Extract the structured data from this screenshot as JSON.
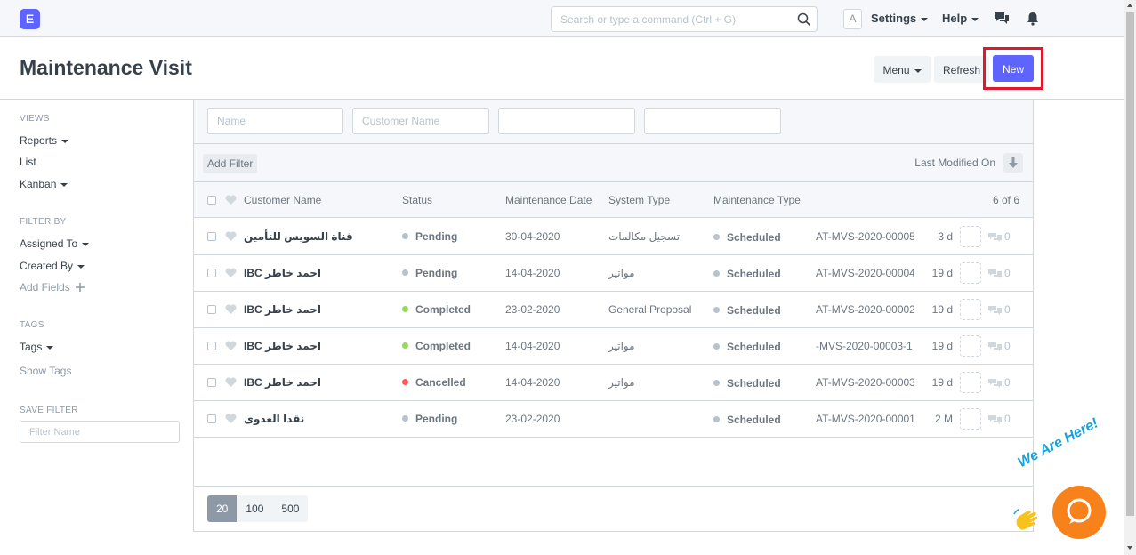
{
  "navbar": {
    "logo": "E",
    "search_placeholder": "Search or type a command (Ctrl + G)",
    "avatar": "A",
    "settings": "Settings",
    "help": "Help"
  },
  "page": {
    "title": "Maintenance Visit",
    "menu_label": "Menu",
    "refresh_label": "Refresh",
    "new_label": "New"
  },
  "sidebar": {
    "views_label": "VIEWS",
    "views": [
      "Reports",
      "List",
      "Kanban"
    ],
    "filter_by_label": "FILTER BY",
    "assigned_to": "Assigned To",
    "created_by": "Created By",
    "add_fields": "Add Fields",
    "tags_label": "TAGS",
    "tags": "Tags",
    "show_tags": "Show Tags",
    "save_filter_label": "SAVE FILTER",
    "filter_name_placeholder": "Filter Name"
  },
  "filters": {
    "name_placeholder": "Name",
    "customer_placeholder": "Customer Name",
    "add_filter": "Add Filter",
    "sort_label": "Last Modified On"
  },
  "list": {
    "headers": {
      "customer_name": "Customer Name",
      "status": "Status",
      "maintenance_date": "Maintenance Date",
      "system_type": "System Type",
      "maintenance_type": "Maintenance Type",
      "count": "6 of 6"
    },
    "rows": [
      {
        "customer": "قناة السويس للتأمين",
        "status": "Pending",
        "status_color": "#b8c2cc",
        "date": "30-04-2020",
        "system": "تسجيل مكالمات",
        "mtype": "Scheduled",
        "doc": "AT-MVS-2020-00005",
        "modified": "3 d",
        "comments": "0"
      },
      {
        "customer": "IBC احمد خاطر",
        "status": "Pending",
        "status_color": "#b8c2cc",
        "date": "14-04-2020",
        "system": "مواتير",
        "mtype": "Scheduled",
        "doc": "AT-MVS-2020-00004",
        "modified": "19 d",
        "comments": "0"
      },
      {
        "customer": "IBC احمد خاطر",
        "status": "Completed",
        "status_color": "#98d85b",
        "date": "23-02-2020",
        "system": "General Proposal",
        "mtype": "Scheduled",
        "doc": "AT-MVS-2020-00002",
        "modified": "19 d",
        "comments": "0"
      },
      {
        "customer": "IBC احمد خاطر",
        "status": "Completed",
        "status_color": "#98d85b",
        "date": "14-04-2020",
        "system": "مواتير",
        "mtype": "Scheduled",
        "doc": "-MVS-2020-00003-1",
        "modified": "19 d",
        "comments": "0"
      },
      {
        "customer": "IBC احمد خاطر",
        "status": "Cancelled",
        "status_color": "#ff5858",
        "date": "14-04-2020",
        "system": "مواتير",
        "mtype": "Scheduled",
        "doc": "AT-MVS-2020-00003",
        "modified": "19 d",
        "comments": "0"
      },
      {
        "customer": "نقدا العدوى",
        "status": "Pending",
        "status_color": "#b8c2cc",
        "date": "23-02-2020",
        "system": "",
        "mtype": "Scheduled",
        "doc": "AT-MVS-2020-00001",
        "modified": "2 M",
        "comments": "0"
      }
    ]
  },
  "paging": [
    "20",
    "100",
    "500"
  ],
  "chat": {
    "text": "We Are Here!"
  }
}
